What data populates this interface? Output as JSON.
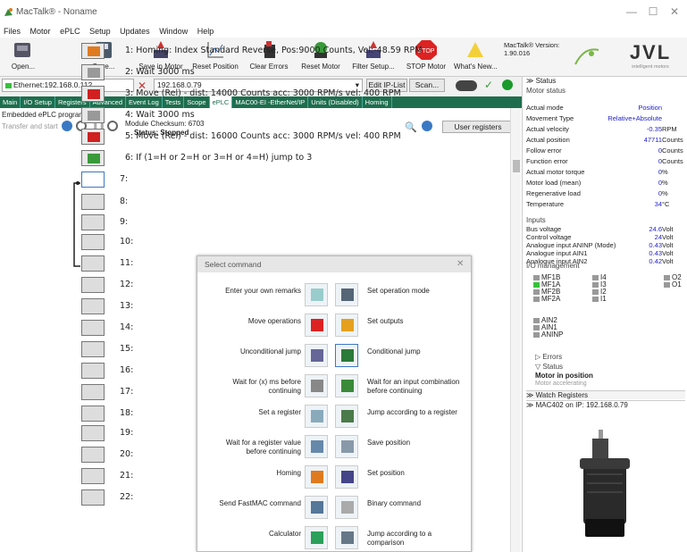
{
  "window": {
    "title": "MacTalk® - Noname",
    "min": "—",
    "max": "☐",
    "close": "✕"
  },
  "menu": [
    "Files",
    "Motor",
    "ePLC",
    "Setup",
    "Updates",
    "Window",
    "Help"
  ],
  "toolbar": [
    {
      "label": "Open...",
      "icon": "open-icon"
    },
    {
      "label": "Save...",
      "icon": "save-icon"
    },
    {
      "label": "Save in Motor",
      "icon": "save-in-motor-icon"
    },
    {
      "label": "Reset Position",
      "icon": "reset-position-icon"
    },
    {
      "label": "Clear Errors",
      "icon": "clear-errors-icon"
    },
    {
      "label": "Reset Motor",
      "icon": "reset-motor-icon"
    },
    {
      "label": "Filter Setup...",
      "icon": "filter-setup-icon"
    },
    {
      "label": "STOP Motor",
      "icon": "stop-icon"
    },
    {
      "label": "What's New...",
      "icon": "whats-new-icon"
    }
  ],
  "version": {
    "label": "MacTalk® Version:",
    "value": "1.90.016"
  },
  "logo": {
    "text": "JVL",
    "tagline": "intelligent motors"
  },
  "connection": {
    "port": "Ethernet:192.168.0.112",
    "ip": "192.168.0.79",
    "edit_btn": "Edit IP-List",
    "scan_btn": "Scan..."
  },
  "tabs": [
    "Main",
    "I/O Setup",
    "Registers",
    "Advanced",
    "Event Log",
    "Tests",
    "Scope",
    "ePLC",
    "MAC00-EI -EtherNet/IP",
    "Units (Disabled)",
    "Homing"
  ],
  "active_tab": "ePLC",
  "eplc": {
    "title": "Embedded ePLC program",
    "transfer": "Transfer and start",
    "checksum": "Module Checksum: 6703",
    "status": "Status: Stopped",
    "user_registers": "User registers",
    "lines": [
      "1: Homing: Index Standard Reverse, Pos:9000 Counts, Vel:-48.59 RPM",
      "2: Wait 3000 ms",
      "3: Move (Rel) - dist: 14000 Counts acc: 3000 RPM/s vel: 400 RPM",
      "4: Wait 3000 ms",
      "5: Move (Rel) - dist: 16000 Counts acc: 3000 RPM/s vel: 400 RPM",
      "6: If (1=H or 2=H or 3=H or 4=H) jump to 3",
      "7:",
      "8:",
      "9:",
      "10:",
      "11:",
      "12:",
      "13:",
      "14:",
      "15:",
      "16:",
      "17:",
      "18:",
      "19:",
      "20:",
      "21:",
      "22:"
    ]
  },
  "dialog": {
    "title": "Select command",
    "close": "✕",
    "left": [
      "Enter your own remarks",
      "Move operations",
      "Unconditional jump",
      "Wait for (x) ms before continuing",
      "Set a register",
      "Wait for a register value before continuing",
      "Homing",
      "Send FastMAC command",
      "Calculator"
    ],
    "right": [
      "Set operation mode",
      "Set outputs",
      "Conditional jump",
      "Wait for an input combination before continuing",
      "Jump according to a register",
      "Save position",
      "Set position",
      "Binary command",
      "Jump according to a comparison"
    ]
  },
  "status": {
    "header": "Status",
    "motor_status": "Motor status",
    "rows": [
      {
        "label": "Actual mode",
        "value": "Position",
        "unit": ""
      },
      {
        "label": "Movement Type",
        "value": "Relative+Absolute",
        "unit": ""
      },
      {
        "label": "Actual velocity",
        "value": "-0.35",
        "unit": "RPM"
      },
      {
        "label": "Actual position",
        "value": "47711",
        "unit": "Counts"
      },
      {
        "label": "Follow error",
        "value": "0",
        "unit": "Counts"
      },
      {
        "label": "Function error",
        "value": "0",
        "unit": "Counts"
      },
      {
        "label": "Actual motor torque",
        "value": "0",
        "unit": "%"
      },
      {
        "label": "Motor load (mean)",
        "value": "0",
        "unit": "%"
      },
      {
        "label": "Regenerative load",
        "value": "0",
        "unit": "%"
      },
      {
        "label": "Temperature",
        "value": "34",
        "unit": "°C"
      }
    ],
    "inputs_title": "Inputs",
    "inputs": [
      {
        "label": "Bus voltage",
        "value": "24.6",
        "unit": "Volt"
      },
      {
        "label": "Control voltage",
        "value": "24",
        "unit": "Volt"
      },
      {
        "label": "Analogue input ANINP (Mode)",
        "value": "0.43",
        "unit": "Volt"
      },
      {
        "label": "Analogue input AIN1",
        "value": "0.43",
        "unit": "Volt"
      },
      {
        "label": "Analogue input AIN2",
        "value": "0.42",
        "unit": "Volt"
      }
    ],
    "io_title": "I/O management",
    "io_left": [
      "MF1B",
      "MF1A",
      "MF2B",
      "MF2A"
    ],
    "io_mid": [
      "I4",
      "I3",
      "I2",
      "I1"
    ],
    "io_right": [
      "O2",
      "O1"
    ],
    "io_an": [
      "AIN2",
      "AIN1",
      "ANINP"
    ],
    "errors": "Errors",
    "status2": "Status",
    "in_position": "Motor in position",
    "accel": "Motor accelerating",
    "watch": "Watch Registers",
    "device": "MAC402 on IP: 192.168.0.79"
  },
  "colors": {
    "tab_bar": "#1e6e4e",
    "value": "#2222cc",
    "led_on": "#36c23b"
  }
}
